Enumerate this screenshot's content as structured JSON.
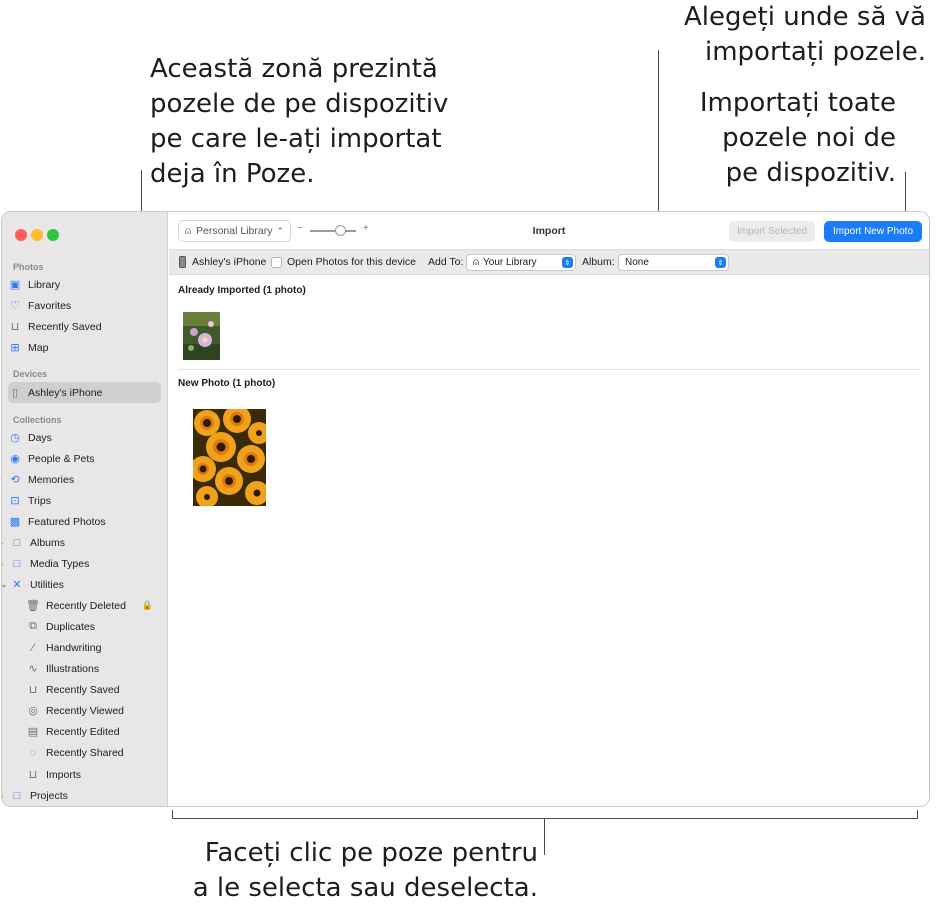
{
  "callouts": {
    "already_imported": "Această zonă prezintă\npozele de pe dispozitiv\npe care le-ați importat\ndeja în Poze.",
    "destination": "Alegeți unde să vă\nimportați pozele.",
    "import_all": "Importați toate\npozele noi de\npe dispozitiv.",
    "click_photos": "Faceți clic pe poze pentru\na le selecta sau deselecta."
  },
  "sidebar": {
    "photos_header": "Photos",
    "photos": [
      {
        "label": "Library",
        "icon": "library-icon"
      },
      {
        "label": "Favorites",
        "icon": "heart-icon"
      },
      {
        "label": "Recently Saved",
        "icon": "tray-icon"
      },
      {
        "label": "Map",
        "icon": "map-icon"
      }
    ],
    "devices_header": "Devices",
    "device": {
      "label": "Ashley's iPhone",
      "icon": "iphone-icon"
    },
    "collections_header": "Collections",
    "collections": [
      {
        "label": "Days",
        "icon": "clock-icon"
      },
      {
        "label": "People & Pets",
        "icon": "person-circle-icon"
      },
      {
        "label": "Memories",
        "icon": "memories-icon"
      },
      {
        "label": "Trips",
        "icon": "suitcase-icon"
      },
      {
        "label": "Featured Photos",
        "icon": "photo-icon"
      },
      {
        "label": "Albums",
        "icon": "folder-icon"
      },
      {
        "label": "Media Types",
        "icon": "folder-icon"
      },
      {
        "label": "Utilities",
        "icon": "tools-icon"
      }
    ],
    "utilities": [
      {
        "label": "Recently Deleted",
        "icon": "trash-icon"
      },
      {
        "label": "Duplicates",
        "icon": "duplicates-icon"
      },
      {
        "label": "Handwriting",
        "icon": "pencil-icon"
      },
      {
        "label": "Illustrations",
        "icon": "illustration-icon"
      },
      {
        "label": "Recently Saved",
        "icon": "tray-icon"
      },
      {
        "label": "Recently Viewed",
        "icon": "eye-icon"
      },
      {
        "label": "Recently Edited",
        "icon": "edit-icon"
      },
      {
        "label": "Recently Shared",
        "icon": "shared-icon"
      },
      {
        "label": "Imports",
        "icon": "tray-icon"
      }
    ],
    "projects": {
      "label": "Projects",
      "icon": "folder-icon"
    }
  },
  "toolbar": {
    "library": "Personal Library",
    "zoom_minus": "−",
    "zoom_plus": "+",
    "title": "Import",
    "import_selected": "Import Selected",
    "import_new": "Import New Photo"
  },
  "options": {
    "device": "Ashley's iPhone",
    "open_photos": "Open Photos for this device",
    "add_to_label": "Add To:",
    "add_to_value": "Your Library",
    "album_label": "Album:",
    "album_value": "None"
  },
  "content": {
    "already_title": "Already Imported (1 photo)",
    "new_title": "New Photo (1 photo)"
  },
  "colors": {
    "accent": "#1a7cf6",
    "sidebar_bg": "#e8e6e6",
    "traffic_close": "#ff5f57",
    "traffic_minimize": "#febc2e",
    "traffic_zoom": "#28c840"
  }
}
